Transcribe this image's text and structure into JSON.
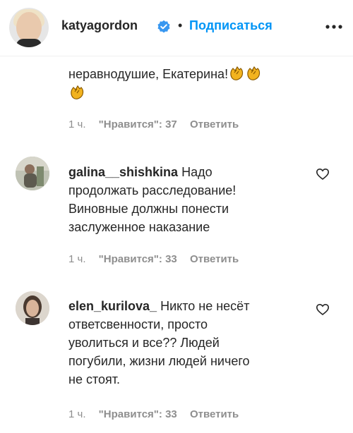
{
  "header": {
    "username": "katyagordon",
    "separator": "•",
    "follow_label": "Подписаться"
  },
  "comments": [
    {
      "username": "",
      "text_line1": "неравнодушие, Екатерина!",
      "time": "1 ч.",
      "likes": "\"Нравится\": 37",
      "reply_label": "Ответить"
    },
    {
      "username": "galina__shishkina",
      "text_line1": "Надо",
      "text_line2": "продолжать расследование!",
      "text_line3": "Виновные должны понести",
      "text_line4": "заслуженное наказание",
      "time": "1 ч.",
      "likes": "\"Нравится\": 33",
      "reply_label": "Ответить"
    },
    {
      "username": "elen_kurilova_",
      "text_line1": "Никто не несёт",
      "text_line2": "ответсвенности, просто",
      "text_line3": "уволиться и все?? Людей",
      "text_line4": "погубили, жизни людей ничего",
      "text_line5": "не стоят.",
      "time": "1 ч.",
      "likes": "\"Нравится\": 33",
      "reply_label": "Ответить"
    }
  ],
  "icons": {
    "verified": "verified-badge-icon",
    "more": "more-options-icon",
    "like": "heart-icon",
    "emoji": "clapping-hands-emoji"
  },
  "colors": {
    "accent": "#0095f6",
    "text": "#262626",
    "muted": "#8e8e8e",
    "clap": "#f2b31f"
  }
}
